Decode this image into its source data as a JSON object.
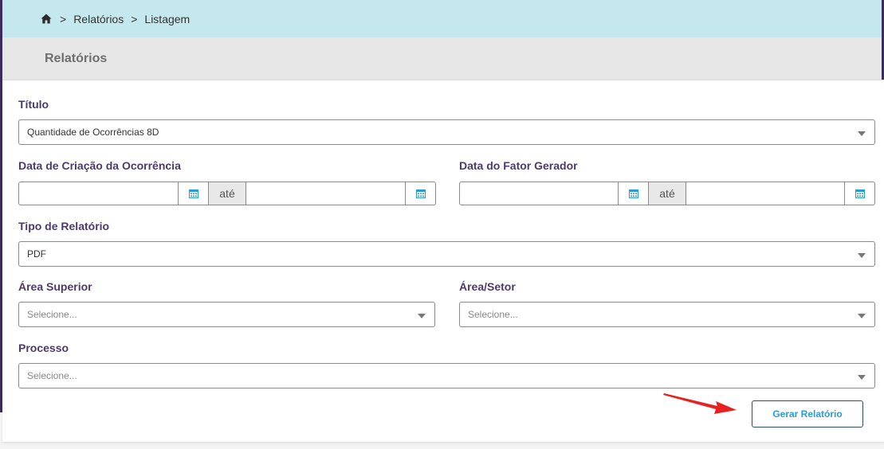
{
  "breadcrumb": {
    "items": [
      "Relatórios",
      "Listagem"
    ],
    "separator": ">"
  },
  "page": {
    "title": "Relatórios"
  },
  "form": {
    "titulo": {
      "label": "Título",
      "value": "Quantidade de Ocorrências 8D"
    },
    "data_criacao": {
      "label": "Data de Criação da Ocorrência",
      "until_label": "até"
    },
    "data_fator": {
      "label": "Data do Fator Gerador",
      "until_label": "até"
    },
    "tipo_relatorio": {
      "label": "Tipo de Relatório",
      "value": "PDF"
    },
    "area_superior": {
      "label": "Área Superior",
      "placeholder": "Selecione..."
    },
    "area_setor": {
      "label": "Área/Setor",
      "placeholder": "Selecione..."
    },
    "processo": {
      "label": "Processo",
      "placeholder": "Selecione..."
    },
    "submit_label": "Gerar Relatório"
  },
  "colors": {
    "accent_text": "#2a9bd4",
    "label_color": "#4b3a6b",
    "breadcrumb_bg": "#c5e8ef",
    "annotation_arrow": "#e8201f"
  },
  "icons": {
    "home": "home-icon",
    "calendar": "calendar-icon",
    "caret": "chevron-down-icon"
  }
}
